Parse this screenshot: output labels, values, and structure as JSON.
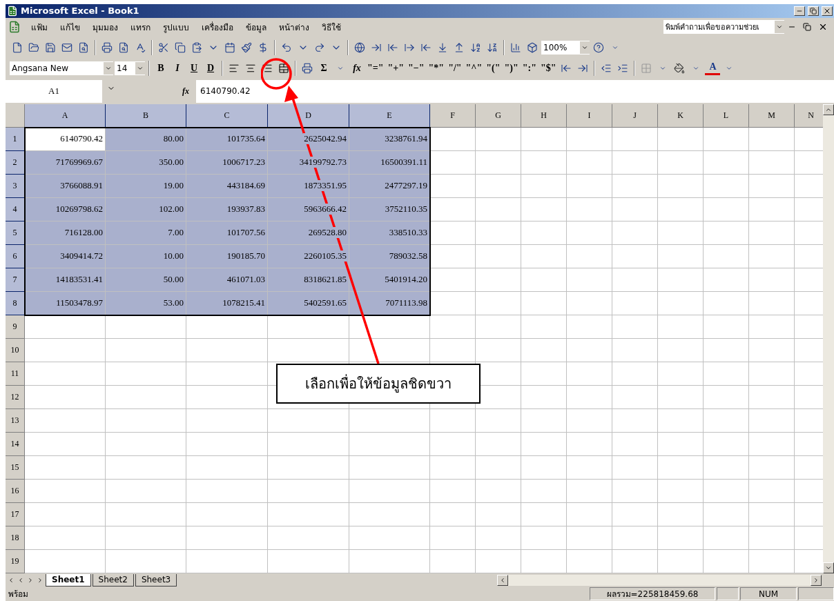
{
  "window": {
    "title": "Microsoft Excel - Book1"
  },
  "menu": [
    "แฟ้ม",
    "แก้ไข",
    "มุมมอง",
    "แทรก",
    "รูปแบบ",
    "เครื่องมือ",
    "ข้อมูล",
    "หน้าต่าง",
    "วิธีใช้"
  ],
  "help_box": {
    "value": "พิมพ์คำถามเพื่อขอความช่วยเ"
  },
  "standard_toolbar": {
    "zoom": "100%"
  },
  "formatting_toolbar": {
    "font": "Angsana New",
    "size": "14",
    "style_buttons": [
      "B",
      "I",
      "U",
      "D"
    ],
    "autosum": "Σ",
    "function": "fx",
    "symbol_buttons": [
      "\"=\"",
      "\"+\"",
      "\"−\"",
      "\"*\"",
      "\"/\"",
      "\"^\"",
      "\"(\"",
      "\")\"",
      "\":\"",
      "\"$\""
    ],
    "font_color": "A"
  },
  "formula_bar": {
    "name_box": "A1",
    "fx": "fx",
    "value": "6140790.42"
  },
  "sheet": {
    "columns": [
      {
        "label": "A",
        "selected": true
      },
      {
        "label": "B",
        "selected": true
      },
      {
        "label": "C",
        "selected": true
      },
      {
        "label": "D",
        "selected": true
      },
      {
        "label": "E",
        "selected": true
      },
      {
        "label": "F",
        "selected": false
      },
      {
        "label": "G",
        "selected": false
      },
      {
        "label": "H",
        "selected": false
      },
      {
        "label": "I",
        "selected": false
      },
      {
        "label": "J",
        "selected": false
      },
      {
        "label": "K",
        "selected": false
      },
      {
        "label": "L",
        "selected": false
      },
      {
        "label": "M",
        "selected": false
      },
      {
        "label": "N",
        "selected": false
      }
    ],
    "rows": [
      {
        "label": "1",
        "selected": true,
        "cells": [
          {
            "text": "6140790.42",
            "active": true
          },
          {
            "text": "80.00",
            "active": false
          },
          {
            "text": "101735.64",
            "active": false
          },
          {
            "text": "2625042.94",
            "active": false
          },
          {
            "text": "3238761.94",
            "active": false
          }
        ]
      },
      {
        "label": "2",
        "selected": true,
        "cells": [
          {
            "text": "71769969.67",
            "active": false
          },
          {
            "text": "350.00",
            "active": false
          },
          {
            "text": "1006717.23",
            "active": false
          },
          {
            "text": "34199792.73",
            "active": false
          },
          {
            "text": "16500391.11",
            "active": false
          }
        ]
      },
      {
        "label": "3",
        "selected": true,
        "cells": [
          {
            "text": "3766088.91",
            "active": false
          },
          {
            "text": "19.00",
            "active": false
          },
          {
            "text": "443184.69",
            "active": false
          },
          {
            "text": "1873351.95",
            "active": false
          },
          {
            "text": "2477297.19",
            "active": false
          }
        ]
      },
      {
        "label": "4",
        "selected": true,
        "cells": [
          {
            "text": "10269798.62",
            "active": false
          },
          {
            "text": "102.00",
            "active": false
          },
          {
            "text": "193937.83",
            "active": false
          },
          {
            "text": "5963666.42",
            "active": false
          },
          {
            "text": "3752110.35",
            "active": false
          }
        ]
      },
      {
        "label": "5",
        "selected": true,
        "cells": [
          {
            "text": "716128.00",
            "active": false
          },
          {
            "text": "7.00",
            "active": false
          },
          {
            "text": "101707.56",
            "active": false
          },
          {
            "text": "269528.80",
            "active": false
          },
          {
            "text": "338510.33",
            "active": false
          }
        ]
      },
      {
        "label": "6",
        "selected": true,
        "cells": [
          {
            "text": "3409414.72",
            "active": false
          },
          {
            "text": "10.00",
            "active": false
          },
          {
            "text": "190185.70",
            "active": false
          },
          {
            "text": "2260105.35",
            "active": false
          },
          {
            "text": "789032.58",
            "active": false
          }
        ]
      },
      {
        "label": "7",
        "selected": true,
        "cells": [
          {
            "text": "14183531.41",
            "active": false
          },
          {
            "text": "50.00",
            "active": false
          },
          {
            "text": "461071.03",
            "active": false
          },
          {
            "text": "8318621.85",
            "active": false
          },
          {
            "text": "5401914.20",
            "active": false
          }
        ]
      },
      {
        "label": "8",
        "selected": true,
        "cells": [
          {
            "text": "11503478.97",
            "active": false
          },
          {
            "text": "53.00",
            "active": false
          },
          {
            "text": "1078215.41",
            "active": false
          },
          {
            "text": "5402591.65",
            "active": false
          },
          {
            "text": "7071113.98",
            "active": false
          }
        ]
      },
      {
        "label": "9",
        "selected": false,
        "cells": []
      },
      {
        "label": "10",
        "selected": false,
        "cells": []
      },
      {
        "label": "11",
        "selected": false,
        "cells": []
      },
      {
        "label": "12",
        "selected": false,
        "cells": []
      },
      {
        "label": "13",
        "selected": false,
        "cells": []
      },
      {
        "label": "14",
        "selected": false,
        "cells": []
      },
      {
        "label": "15",
        "selected": false,
        "cells": []
      },
      {
        "label": "16",
        "selected": false,
        "cells": []
      },
      {
        "label": "17",
        "selected": false,
        "cells": []
      },
      {
        "label": "18",
        "selected": false,
        "cells": []
      },
      {
        "label": "19",
        "selected": false,
        "cells": []
      }
    ]
  },
  "sheet_tabs": [
    {
      "label": "Sheet1",
      "selected": true
    },
    {
      "label": "Sheet2",
      "selected": false
    },
    {
      "label": "Sheet3",
      "selected": false
    }
  ],
  "status_bar": {
    "mode": "พร้อม",
    "sum": "ผลรวม=225818459.68",
    "num": "NUM"
  },
  "callout": {
    "text": "เลือกเพื่อให้ข้อมูลชิดขวา"
  }
}
